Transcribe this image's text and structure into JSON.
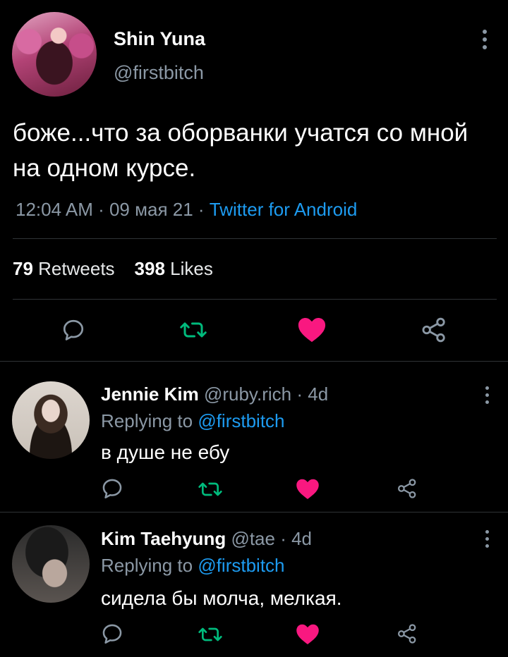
{
  "main_tweet": {
    "author_name": "Shin Yuna",
    "author_handle": "@firstbitch",
    "text": "боже...что за оборванки учатся со мной на одном курсе.",
    "time": "12:04 AM",
    "date": "09 мая 21",
    "source": "Twitter for Android",
    "sep1": " · ",
    "sep2": " · ",
    "retweets_count": "79",
    "retweets_label": "Retweets",
    "likes_count": "398",
    "likes_label": "Likes"
  },
  "replies": [
    {
      "author_name": "Jennie Kim",
      "author_handle": "@ruby.rich",
      "age": "4d",
      "replying_prefix": "Replying to ",
      "replying_to": "@firstbitch",
      "text": "в душе не ебу"
    },
    {
      "author_name": "Kim Taehyung",
      "author_handle": "@tae",
      "age": "4d",
      "replying_prefix": "Replying to ",
      "replying_to": "@firstbitch",
      "text": "сидела бы молча, мелкая."
    }
  ],
  "icons": {
    "reply": "reply-icon",
    "retweet": "retweet-icon",
    "like": "heart-icon",
    "share": "share-icon",
    "more": "more-vertical-icon"
  },
  "colors": {
    "background": "#000000",
    "text_primary": "#ffffff",
    "text_secondary": "#8b98a5",
    "link": "#1d9bf0",
    "retweet_green": "#00ba7c",
    "like_red": "#f91880",
    "divider": "#2f3336"
  }
}
